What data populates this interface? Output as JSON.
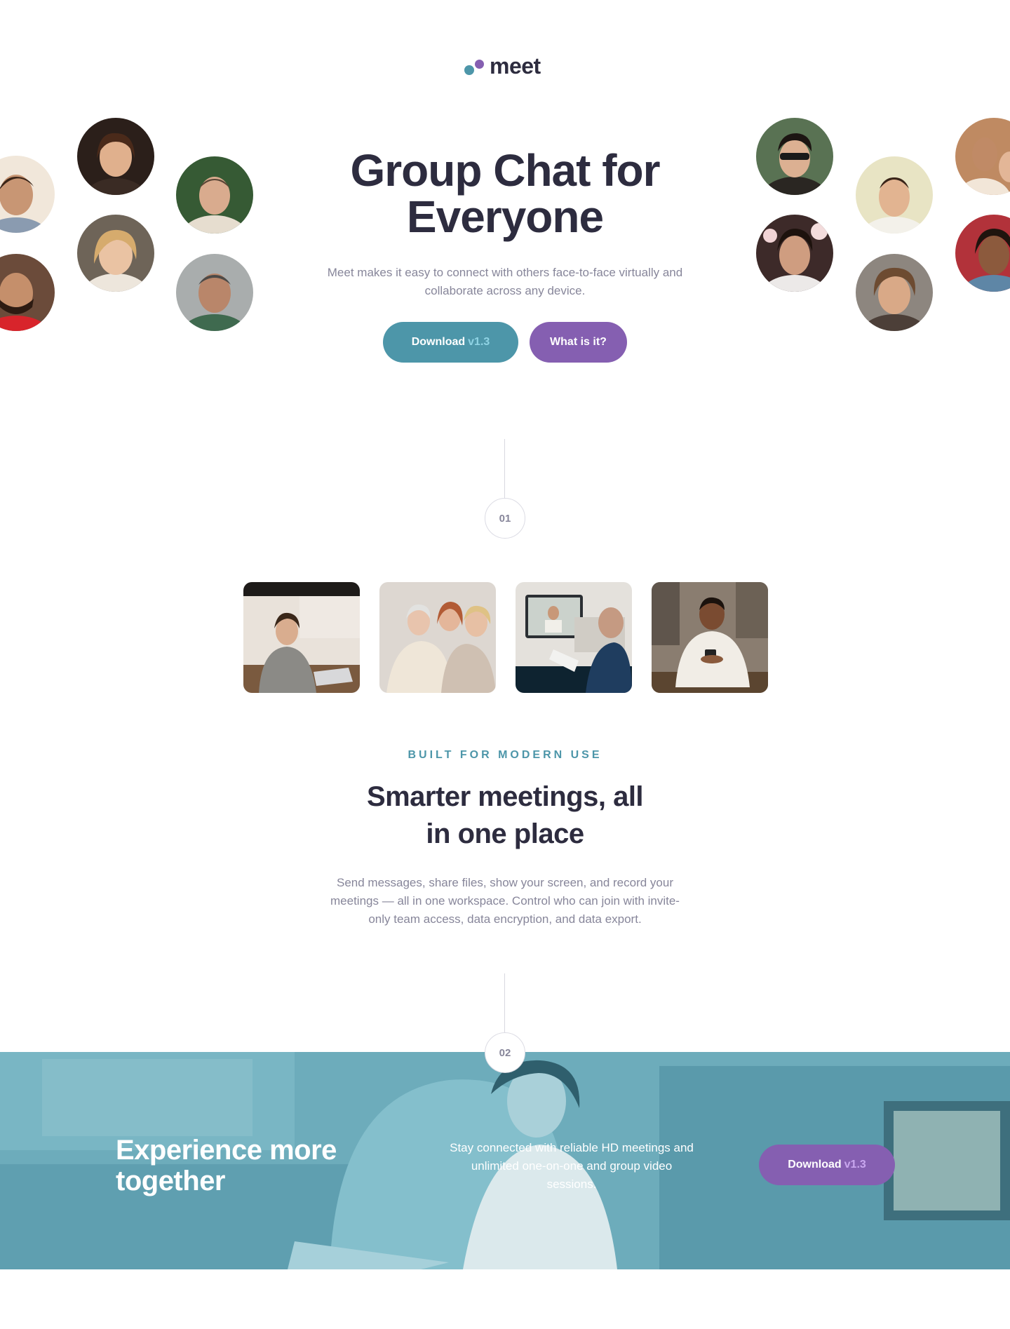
{
  "logo": {
    "text": "meet"
  },
  "hero": {
    "title_line1": "Group Chat for",
    "title_line2": "Everyone",
    "subtitle": "Meet makes it easy to connect with others face-to-face virtually and collaborate across any device.",
    "download_label": "Download",
    "download_version": "v1.3",
    "what_label": "What is it?"
  },
  "steps": {
    "one": "01",
    "two": "02"
  },
  "features": {
    "eyebrow": "BUILT FOR MODERN USE",
    "title_line1": "Smarter meetings, all",
    "title_line2": "in one place",
    "body": "Send messages, share files, show your screen, and record your meetings — all in one workspace. Control who can join with invite-only team access, data encryption, and data export."
  },
  "banner": {
    "title_line1": "Experience more",
    "title_line2": "together",
    "text": "Stay connected with reliable HD meetings and unlimited one-on-one and group video sessions.",
    "download_label": "Download",
    "download_version": "v1.3"
  },
  "colors": {
    "teal": "#4d96a9",
    "purple": "#855fb1",
    "navy": "#2d2c3f",
    "grey_text": "#87869a"
  },
  "icons": {
    "logo": "two-dots-logo-icon",
    "avatars": "person-photo-icon",
    "tiles": "photo-icon"
  }
}
